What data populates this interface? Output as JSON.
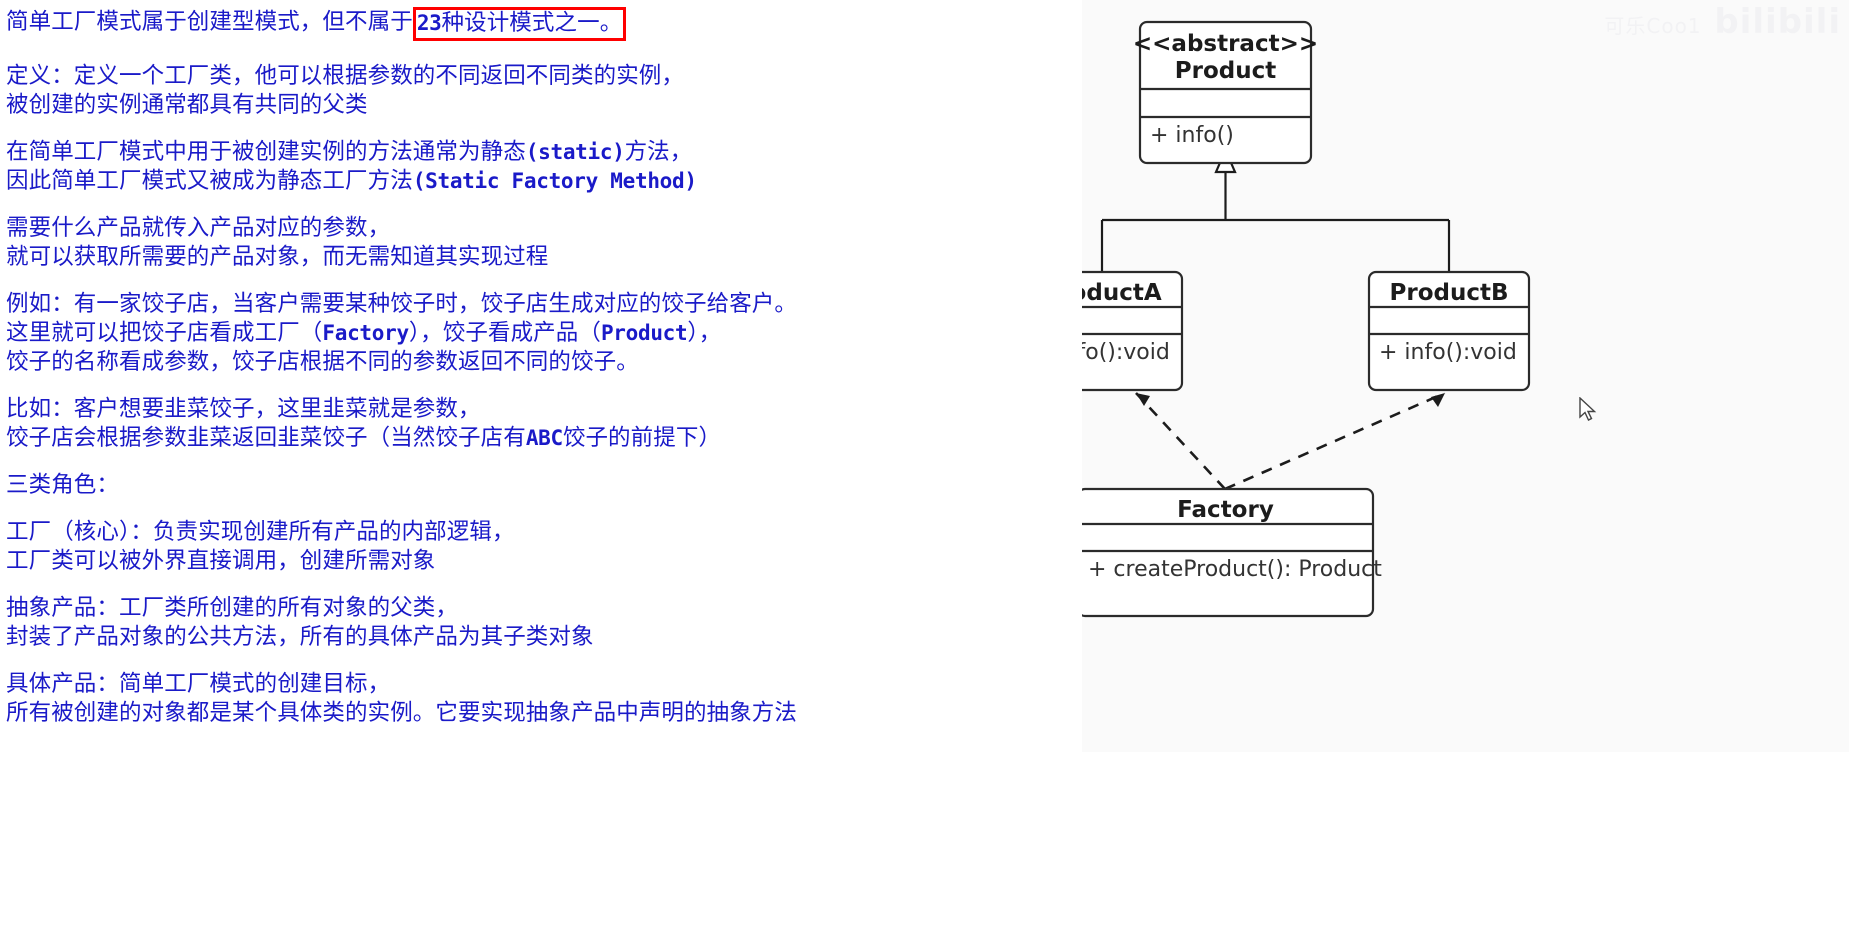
{
  "notes": {
    "paragraphs": [
      {
        "id": "p-intro",
        "lines": [
          {
            "pre": "简单工厂模式属于创建型模式，但不属于",
            "highlight": {
              "num": "23",
              "rest": "种设计模式之一。"
            }
          }
        ]
      },
      {
        "id": "p-definition",
        "lines": [
          {
            "text": "定义：定义一个工厂类，他可以根据参数的不同返回不同类的实例，"
          },
          {
            "text": "被创建的实例通常都具有共同的父类"
          }
        ]
      },
      {
        "id": "p-static",
        "lines": [
          {
            "text": "在简单工厂模式中用于被创建实例的方法通常为静态",
            "en": "(static)",
            "post": "方法，"
          },
          {
            "text": "因此简单工厂模式又被成为静态工厂方法",
            "en": "(Static Factory Method)",
            "post": ""
          }
        ]
      },
      {
        "id": "p-usage",
        "lines": [
          {
            "text": "需要什么产品就传入产品对应的参数，"
          },
          {
            "text": "就可以获取所需要的产品对象，而无需知道其实现过程"
          }
        ]
      },
      {
        "id": "p-example",
        "lines": [
          {
            "text": "例如：有一家饺子店，当客户需要某种饺子时，饺子店生成对应的饺子给客户。"
          },
          {
            "text": "这里就可以把饺子店看成工厂（",
            "en": "Factory",
            "post": "），饺子看成产品（",
            "en2": "Product",
            "post2": "），"
          },
          {
            "text": "饺子的名称看成参数，饺子店根据不同的参数返回不同的饺子。"
          }
        ]
      },
      {
        "id": "p-example2",
        "lines": [
          {
            "text": "比如：客户想要韭菜饺子，这里韭菜就是参数，"
          },
          {
            "text": "饺子店会根据参数韭菜返回韭菜饺子（当然饺子店有",
            "en": "ABC",
            "post": "饺子的前提下）"
          }
        ]
      },
      {
        "id": "p-roles-header",
        "lines": [
          {
            "text": "三类角色："
          }
        ]
      },
      {
        "id": "p-role-factory",
        "lines": [
          {
            "text": "工厂（核心）：负责实现创建所有产品的内部逻辑，"
          },
          {
            "text": "工厂类可以被外界直接调用，创建所需对象"
          }
        ]
      },
      {
        "id": "p-role-abstract",
        "lines": [
          {
            "text": "抽象产品：工厂类所创建的所有对象的父类，"
          },
          {
            "text": "封装了产品对象的公共方法，所有的具体产品为其子类对象"
          }
        ]
      },
      {
        "id": "p-role-concrete",
        "lines": [
          {
            "text": "具体产品：简单工厂模式的创建目标，"
          },
          {
            "text": "所有被创建的对象都是某个具体类的实例。它要实现抽象产品中声明的抽象方法"
          }
        ]
      }
    ]
  },
  "diagram": {
    "type": "uml-class-diagram",
    "classes": [
      {
        "id": "product",
        "stereotype": "<<abstract>>",
        "name": "Product",
        "attributes": [],
        "methods": [
          "+ info()"
        ]
      },
      {
        "id": "productA",
        "stereotype": "",
        "name": "ProductA",
        "attributes": [],
        "methods": [
          "+ info():void"
        ]
      },
      {
        "id": "productB",
        "stereotype": "",
        "name": "ProductB",
        "attributes": [],
        "methods": [
          "+ info():void"
        ]
      },
      {
        "id": "factory",
        "stereotype": "",
        "name": "Factory",
        "attributes": [],
        "methods": [
          "+ createProduct():  Product"
        ]
      }
    ],
    "relations": [
      {
        "from": "productA",
        "to": "product",
        "kind": "generalization",
        "style": "solid"
      },
      {
        "from": "productB",
        "to": "product",
        "kind": "generalization",
        "style": "solid"
      },
      {
        "from": "factory",
        "to": "productA",
        "kind": "dependency",
        "style": "dashed"
      },
      {
        "from": "factory",
        "to": "productB",
        "kind": "dependency",
        "style": "dashed"
      }
    ],
    "panel_background": "#fafafa"
  },
  "watermark": {
    "handle": "可乐Coo1",
    "brand": "bilibili"
  },
  "colors": {
    "note_text": "#1a1ac8",
    "highlight_border": "#ff0000",
    "diagram_stroke": "#2b2b2b",
    "page_background": "#ffffff",
    "panel_background": "#fafafa"
  }
}
